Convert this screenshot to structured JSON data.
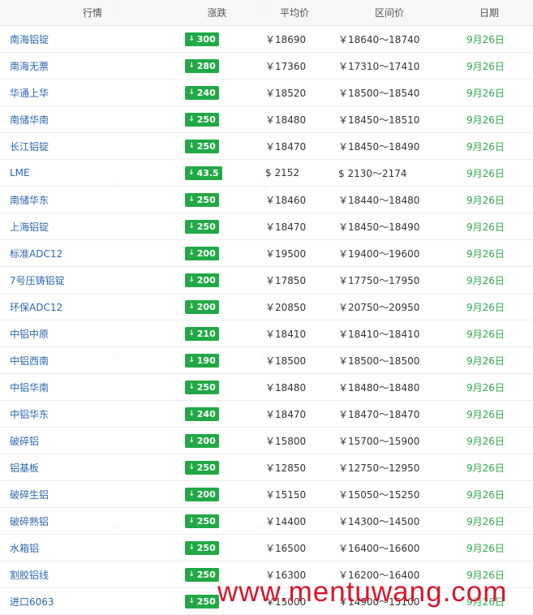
{
  "headers": {
    "name": "行情",
    "change": "涨跌",
    "avg": "平均价",
    "range": "区间价",
    "date": "日期"
  },
  "rows": [
    {
      "name": "南海铝锭",
      "change": "300",
      "avg": "￥18690",
      "range": "￥18640～18740",
      "date": "9月26日"
    },
    {
      "name": "南海无票",
      "change": "280",
      "avg": "￥17360",
      "range": "￥17310～17410",
      "date": "9月26日"
    },
    {
      "name": "华通上华",
      "change": "240",
      "avg": "￥18520",
      "range": "￥18500～18540",
      "date": "9月26日"
    },
    {
      "name": "南储华南",
      "change": "250",
      "avg": "￥18480",
      "range": "￥18450～18510",
      "date": "9月26日"
    },
    {
      "name": "长江铝锭",
      "change": "250",
      "avg": "￥18470",
      "range": "￥18450～18490",
      "date": "9月26日"
    },
    {
      "name": "LME",
      "change": "43.5",
      "avg": "$ 2152",
      "range": "$ 2130～2174",
      "date": "9月26日"
    },
    {
      "name": "南储华东",
      "change": "250",
      "avg": "￥18460",
      "range": "￥18440～18480",
      "date": "9月26日"
    },
    {
      "name": "上海铝锭",
      "change": "250",
      "avg": "￥18470",
      "range": "￥18450～18490",
      "date": "9月26日"
    },
    {
      "name": "标准ADC12",
      "change": "200",
      "avg": "￥19500",
      "range": "￥19400～19600",
      "date": "9月26日"
    },
    {
      "name": "7号压铸铝锭",
      "change": "200",
      "avg": "￥17850",
      "range": "￥17750～17950",
      "date": "9月26日"
    },
    {
      "name": "环保ADC12",
      "change": "200",
      "avg": "￥20850",
      "range": "￥20750～20950",
      "date": "9月26日"
    },
    {
      "name": "中铝中原",
      "change": "210",
      "avg": "￥18410",
      "range": "￥18410～18410",
      "date": "9月26日"
    },
    {
      "name": "中铝西南",
      "change": "190",
      "avg": "￥18500",
      "range": "￥18500～18500",
      "date": "9月26日"
    },
    {
      "name": "中铝华南",
      "change": "250",
      "avg": "￥18480",
      "range": "￥18480～18480",
      "date": "9月26日"
    },
    {
      "name": "中铝华东",
      "change": "240",
      "avg": "￥18470",
      "range": "￥18470～18470",
      "date": "9月26日"
    },
    {
      "name": "破碎铝",
      "change": "200",
      "avg": "￥15800",
      "range": "￥15700～15900",
      "date": "9月26日"
    },
    {
      "name": "铝基板",
      "change": "250",
      "avg": "￥12850",
      "range": "￥12750～12950",
      "date": "9月26日"
    },
    {
      "name": "破碎生铝",
      "change": "200",
      "avg": "￥15150",
      "range": "￥15050～15250",
      "date": "9月26日"
    },
    {
      "name": "破碎熟铝",
      "change": "250",
      "avg": "￥14400",
      "range": "￥14300～14500",
      "date": "9月26日"
    },
    {
      "name": "水箱铝",
      "change": "250",
      "avg": "￥16500",
      "range": "￥16400～16600",
      "date": "9月26日"
    },
    {
      "name": "割胶铝线",
      "change": "250",
      "avg": "￥16300",
      "range": "￥16200～16400",
      "date": "9月26日"
    },
    {
      "name": "进口6063",
      "change": "250",
      "avg": "￥15000",
      "range": "￥14900～15100",
      "date": "9月26日"
    }
  ],
  "overlay_text": "www.mentuwang.com",
  "colors": {
    "up_badge": "#22a846",
    "date_green": "#2ea84a",
    "link_blue": "#2b67b1",
    "overlay_red": "#d8162a"
  },
  "icons": {
    "change_arrow": "down-arrow-icon"
  }
}
